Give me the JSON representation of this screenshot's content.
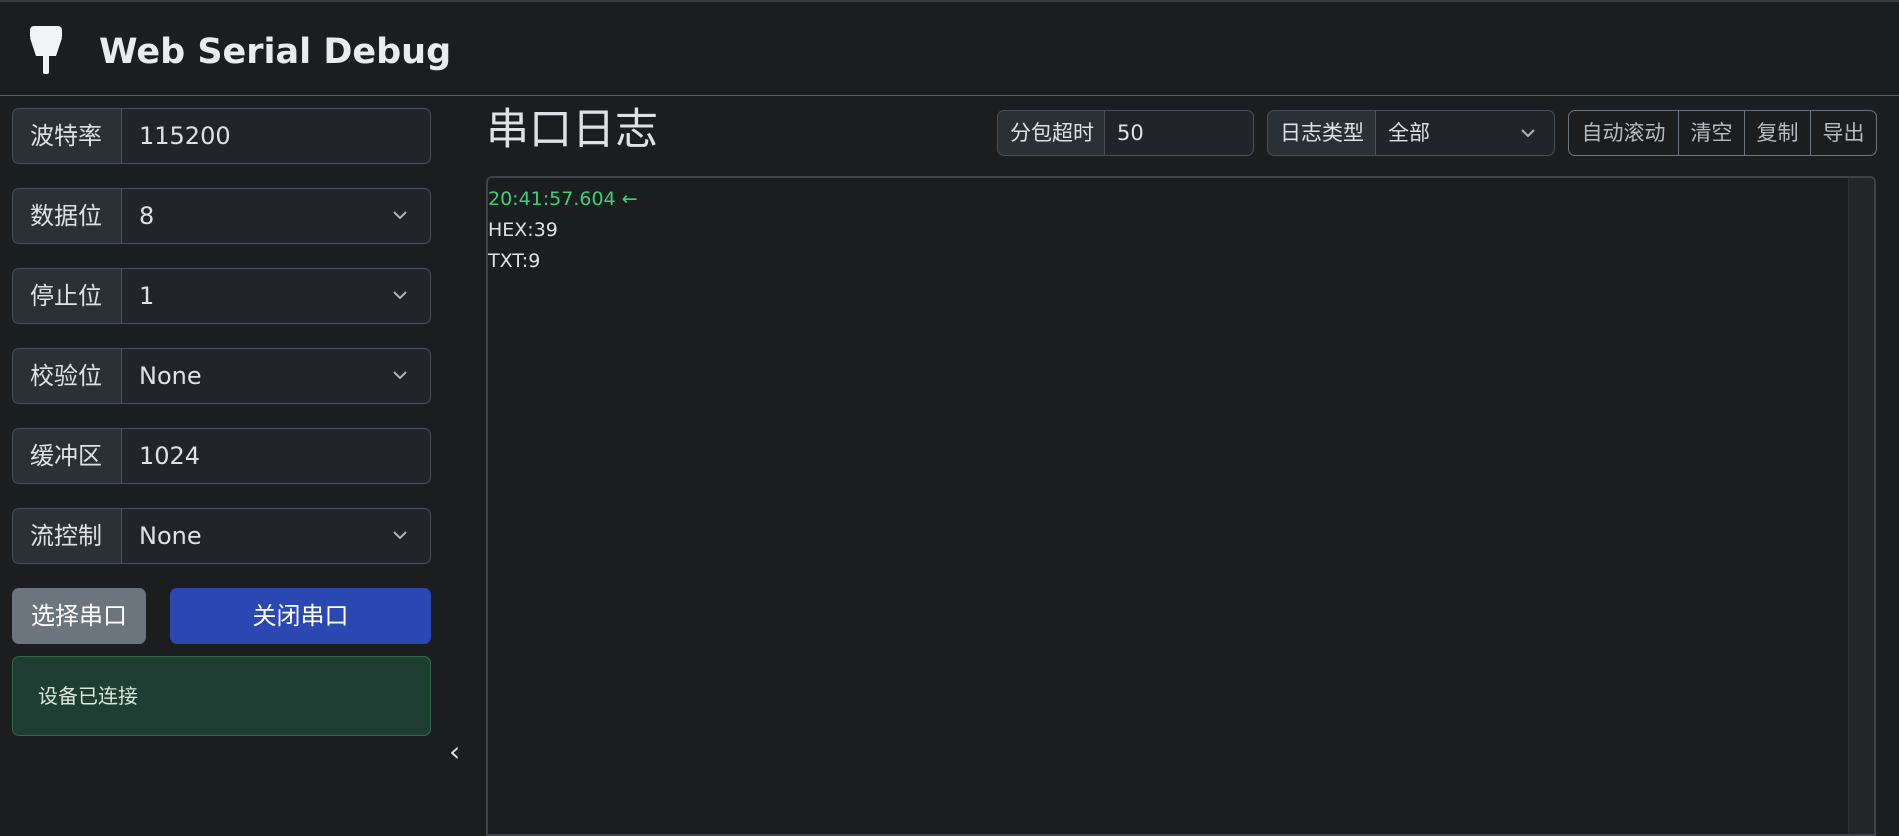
{
  "app": {
    "title": "Web Serial Debug",
    "logo_icon": "usb-plug-icon"
  },
  "settings": {
    "baud": {
      "label": "波特率",
      "value": "115200"
    },
    "data_bits": {
      "label": "数据位",
      "value": "8"
    },
    "stop_bits": {
      "label": "停止位",
      "value": "1"
    },
    "parity": {
      "label": "校验位",
      "value": "None"
    },
    "buffer": {
      "label": "缓冲区",
      "value": "1024"
    },
    "flow_control": {
      "label": "流控制",
      "value": "None"
    },
    "select_port_label": "选择串口",
    "close_port_label": "关闭串口",
    "status_message": "设备已连接",
    "collapse_icon": "‹"
  },
  "log": {
    "title": "串口日志",
    "packet_timeout": {
      "label": "分包超时",
      "value": "50"
    },
    "log_type": {
      "label": "日志类型",
      "value": "全部"
    },
    "buttons": {
      "autoscroll": "自动滚动",
      "clear": "清空",
      "copy": "复制",
      "export": "导出"
    },
    "entries": [
      {
        "time": "20:41:57.604 ←",
        "hex": "HEX:39",
        "txt": "TXT:9"
      }
    ]
  },
  "colors": {
    "primary": "#2b47b2",
    "secondary": "#6c757d",
    "success_bg": "#1f3d32",
    "timestamp": "#3ed07a"
  }
}
